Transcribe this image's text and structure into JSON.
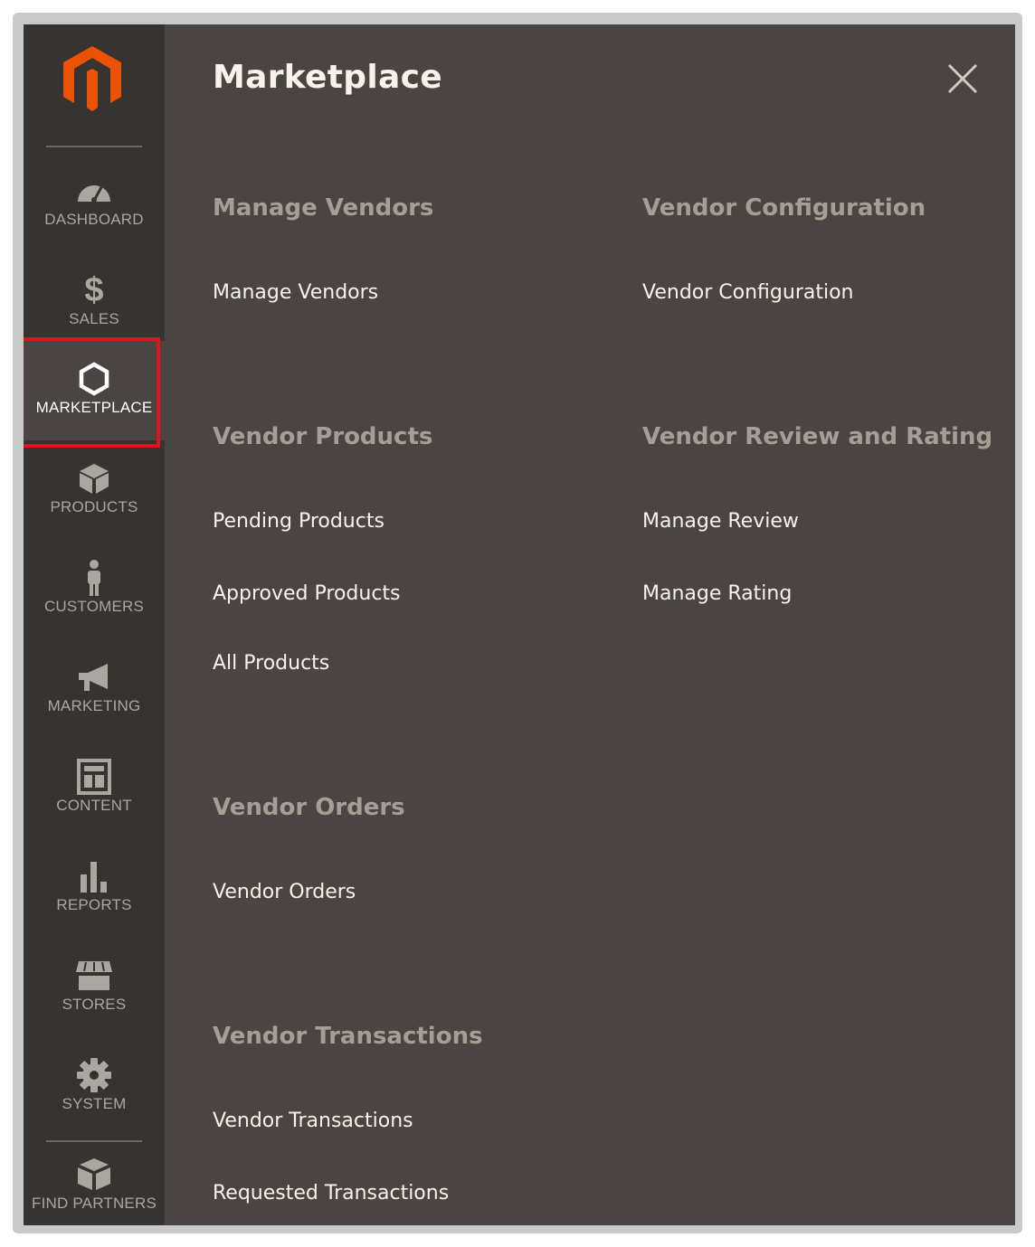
{
  "sidebar": {
    "logo": "magento-logo",
    "items": [
      {
        "key": "dashboard",
        "label": "DASHBOARD",
        "icon": "speedometer-icon"
      },
      {
        "key": "sales",
        "label": "SALES",
        "icon": "dollar-icon"
      },
      {
        "key": "marketplace",
        "label": "MARKETPLACE",
        "icon": "hexagon-icon",
        "active": true
      },
      {
        "key": "products",
        "label": "PRODUCTS",
        "icon": "cube-icon"
      },
      {
        "key": "customers",
        "label": "CUSTOMERS",
        "icon": "person-icon"
      },
      {
        "key": "marketing",
        "label": "MARKETING",
        "icon": "megaphone-icon"
      },
      {
        "key": "content",
        "label": "CONTENT",
        "icon": "layout-icon"
      },
      {
        "key": "reports",
        "label": "REPORTS",
        "icon": "bar-chart-icon"
      },
      {
        "key": "stores",
        "label": "STORES",
        "icon": "storefront-icon"
      },
      {
        "key": "system",
        "label": "SYSTEM",
        "icon": "gear-icon"
      },
      {
        "key": "find_partners",
        "label": "FIND PARTNERS",
        "icon": "boxes-icon"
      }
    ]
  },
  "panel": {
    "title": "Marketplace",
    "close_icon": "close-icon",
    "sections": [
      {
        "heading": "Manage Vendors",
        "links": [
          "Manage Vendors"
        ]
      },
      {
        "heading": "Vendor Configuration",
        "links": [
          "Vendor Configuration"
        ]
      },
      {
        "heading": "Vendor Products",
        "links": [
          "Pending Products",
          "Approved Products",
          "All Products"
        ]
      },
      {
        "heading": "Vendor Review and Rating",
        "links": [
          "Manage Review",
          "Manage Rating"
        ]
      },
      {
        "heading": "Vendor Orders",
        "links": [
          "Vendor Orders"
        ]
      },
      {
        "heading": "Vendor Transactions",
        "links": [
          "Vendor Transactions",
          "Requested Transactions"
        ]
      }
    ]
  },
  "colors": {
    "sidebar_bg": "#373330",
    "panel_bg": "#4a4542",
    "logo_orange": "#eb5202",
    "highlight_red": "#e0121a",
    "heading_gray": "#a79d95",
    "link_white": "#f7f3eb"
  }
}
